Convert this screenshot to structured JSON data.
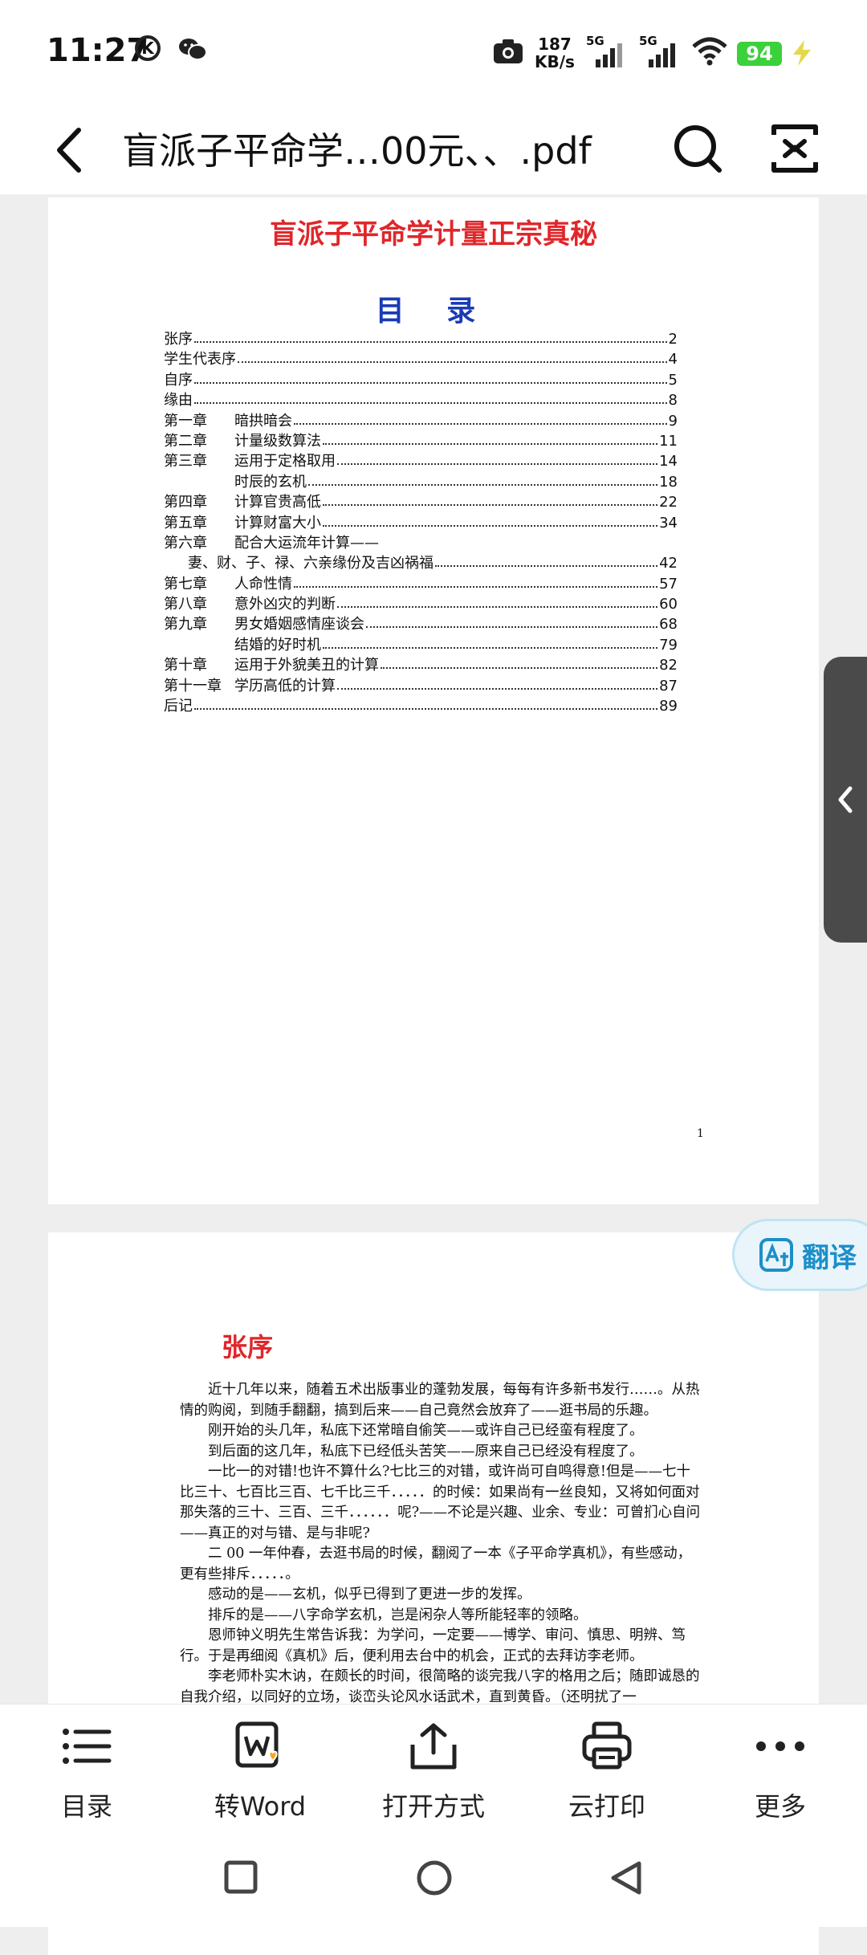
{
  "status_bar": {
    "time": "11:27",
    "k_badge": "K",
    "speed_value": "187",
    "speed_unit": "KB/s",
    "sig1_label": "5G",
    "sig2_label": "5G",
    "battery": "94"
  },
  "header": {
    "title": "盲派子平命学…00元、、.pdf"
  },
  "page1": {
    "title": "盲派子平命学计量正宗真秘",
    "toc_heading": "目 录",
    "toc": [
      {
        "ch": "",
        "text": "张序",
        "page": "2"
      },
      {
        "ch": "",
        "text": "学生代表序",
        "page": "4"
      },
      {
        "ch": "",
        "text": "自序",
        "page": "5"
      },
      {
        "ch": "",
        "text": "缘由",
        "page": "8"
      },
      {
        "ch": "第一章",
        "text": "暗拱暗会",
        "page": "9"
      },
      {
        "ch": "第二章",
        "text": "计量级数算法",
        "page": "11"
      },
      {
        "ch": "第三章",
        "text": "运用于定格取用",
        "page": "14"
      },
      {
        "ch": "",
        "text": "时辰的玄机",
        "page": "18",
        "indent": true
      },
      {
        "ch": "第四章",
        "text": "计算官贵高低",
        "page": "22"
      },
      {
        "ch": "第五章",
        "text": "计算财富大小",
        "page": "34"
      },
      {
        "ch": "第六章",
        "text": "配合大运流年计算——",
        "page": "",
        "nodots": true
      },
      {
        "ch": "",
        "text": "妻、财、子、禄、六亲缘份及吉凶祸福",
        "page": "42",
        "sub": true
      },
      {
        "ch": "第七章",
        "text": "人命性情",
        "page": "57"
      },
      {
        "ch": "第八章",
        "text": "意外凶灾的判断",
        "page": "60"
      },
      {
        "ch": "第九章",
        "text": "男女婚姻感情座谈会",
        "page": "68"
      },
      {
        "ch": "",
        "text": "结婚的好时机",
        "page": "79",
        "indent": true
      },
      {
        "ch": "第十章",
        "text": "运用于外貌美丑的计算",
        "page": "82"
      },
      {
        "ch": "第十一章",
        "text": "学历高低的计算",
        "page": "87"
      },
      {
        "ch": "",
        "text": "后记",
        "page": "89"
      }
    ],
    "page_number": "1"
  },
  "page2": {
    "title": "张序",
    "paragraphs": [
      "近十几年以来，随着五术出版事业的蓬勃发展，每每有许多新书发行……。从热情的购阅，到随手翻翻，搞到后来——自己竟然会放弃了——逛书局的乐趣。",
      "刚开始的头几年，私底下还常暗自偷笑——或许自己已经蛮有程度了。",
      "到后面的这几年，私底下已经低头苦笑——原来自己已经没有程度了。",
      "一比一的对错!也许不算什么?七比三的对错，或许尚可自鸣得意!但是——七十比三十、七百比三百、七千比三千．．．．．的时候：如果尚有一丝良知，又将如何面对那失落的三十、三百、三千．．．．．．呢?——不论是兴趣、业余、专业：可曾扪心自问——真正的对与错、是与非呢?",
      "二 00 一年仲春，去逛书局的时候，翻阅了一本《子平命学真机》，有些感动，更有些排斥．．．．．。",
      "感动的是——玄机，似乎已得到了更进一步的发挥。",
      "排斥的是——八字命学玄机，岂是闲杂人等所能轻率的领略。",
      "恩师钟义明先生常告诉我：为学问，一定要——博学、审问、慎思、明辨、笃行。于是再细阅《真机》后，便利用去台中的机会，正式的去拜访李老师。",
      "李老师朴实木讷，在颇长的时间，很简略的谈完我八字的格用之后；随即诚恳的自我介绍，以同好的立场，谈峦头论风水话武术，直到黄昏。（还明扰了一"
    ]
  },
  "translate": {
    "label": "翻译"
  },
  "toolbar": {
    "items": [
      {
        "label": "目录",
        "icon": "list-icon"
      },
      {
        "label": "转Word",
        "icon": "word-convert-icon"
      },
      {
        "label": "打开方式",
        "icon": "share-icon"
      },
      {
        "label": "云打印",
        "icon": "printer-icon"
      },
      {
        "label": "更多",
        "icon": "more-dots-icon"
      }
    ]
  },
  "colors": {
    "title_red": "#e0262a",
    "heading_blue": "#1a3bb5",
    "battery_green": "#3bd13b",
    "translate_blue": "#1c8fc8"
  }
}
